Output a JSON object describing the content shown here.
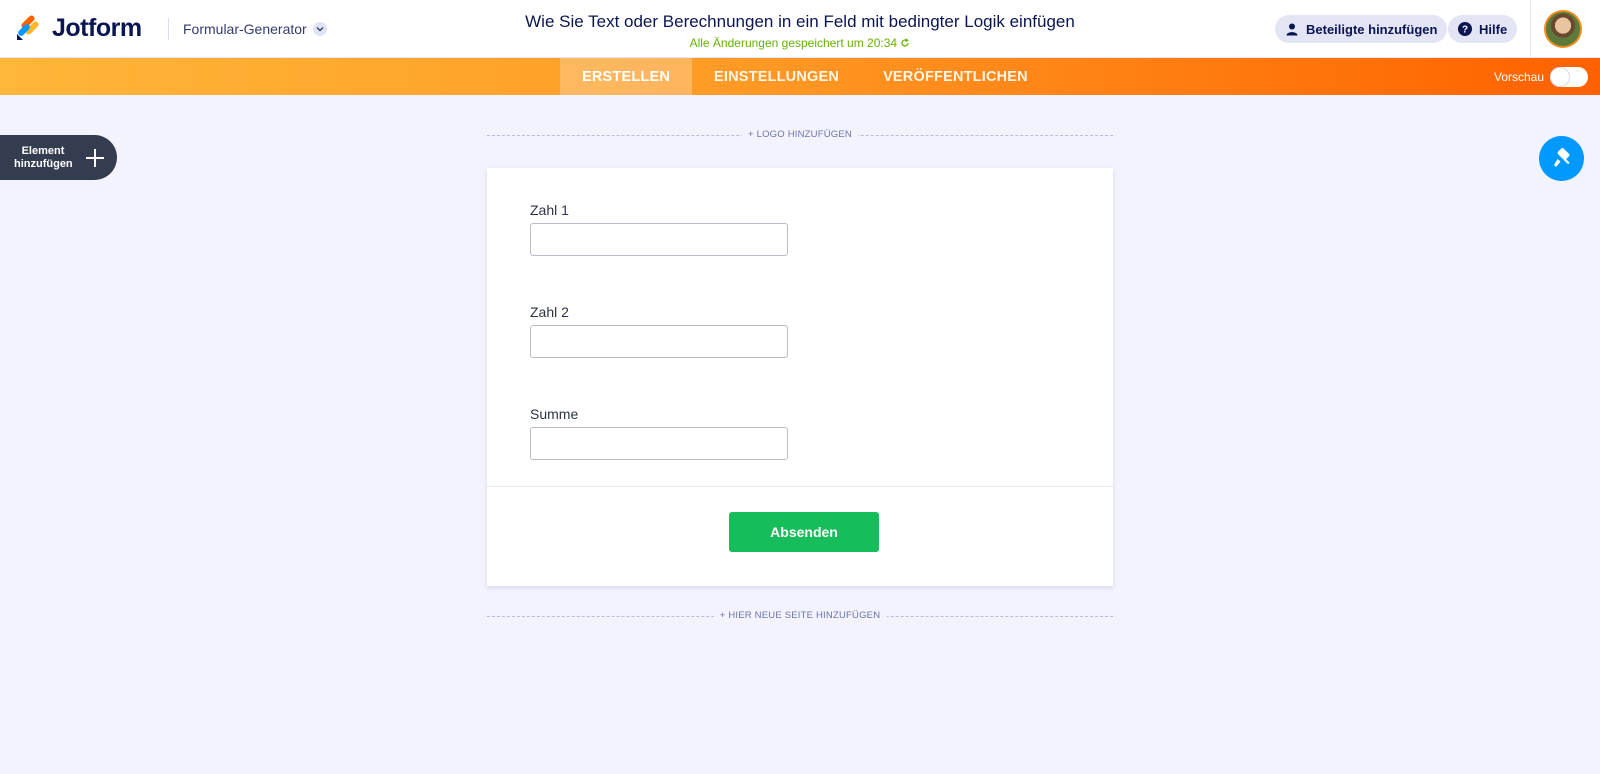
{
  "header": {
    "logo_text": "Jotform",
    "builder_menu_label": "Formular-Generator",
    "form_title": "Wie Sie Text oder Berechnungen in ein Feld mit bedingter Logik einfügen",
    "save_status": "Alle Änderungen gespeichert um 20:34",
    "invite_label": "Beteiligte hinzufügen",
    "help_label": "Hilfe"
  },
  "navbar": {
    "tabs": [
      {
        "label": "ERSTELLEN",
        "active": true
      },
      {
        "label": "EINSTELLUNGEN",
        "active": false
      },
      {
        "label": "VERÖFFENTLICHEN",
        "active": false
      }
    ],
    "preview_label": "Vorschau",
    "preview_on": false
  },
  "sidebar": {
    "add_element_line1": "Element",
    "add_element_line2": "hinzufügen"
  },
  "canvas": {
    "add_logo_label": "+ LOGO HINZUFÜGEN",
    "add_page_label": "+ HIER NEUE SEITE HINZUFÜGEN"
  },
  "form": {
    "fields": [
      {
        "label": "Zahl 1",
        "value": ""
      },
      {
        "label": "Zahl 2",
        "value": ""
      },
      {
        "label": "Summe",
        "value": ""
      }
    ],
    "submit_label": "Absenden"
  },
  "colors": {
    "brand_orange": "#ff6100",
    "submit_green": "#18bd5b",
    "designer_blue": "#0099ff",
    "save_green": "#64b200",
    "background": "#f3f3fe"
  },
  "icons": {
    "logo": "jotform-logo-icon",
    "chevron": "chevron-down-icon",
    "refresh": "refresh-icon",
    "invite": "user-icon",
    "help": "help-icon",
    "add": "plus-icon",
    "designer": "paint-roller-icon"
  }
}
